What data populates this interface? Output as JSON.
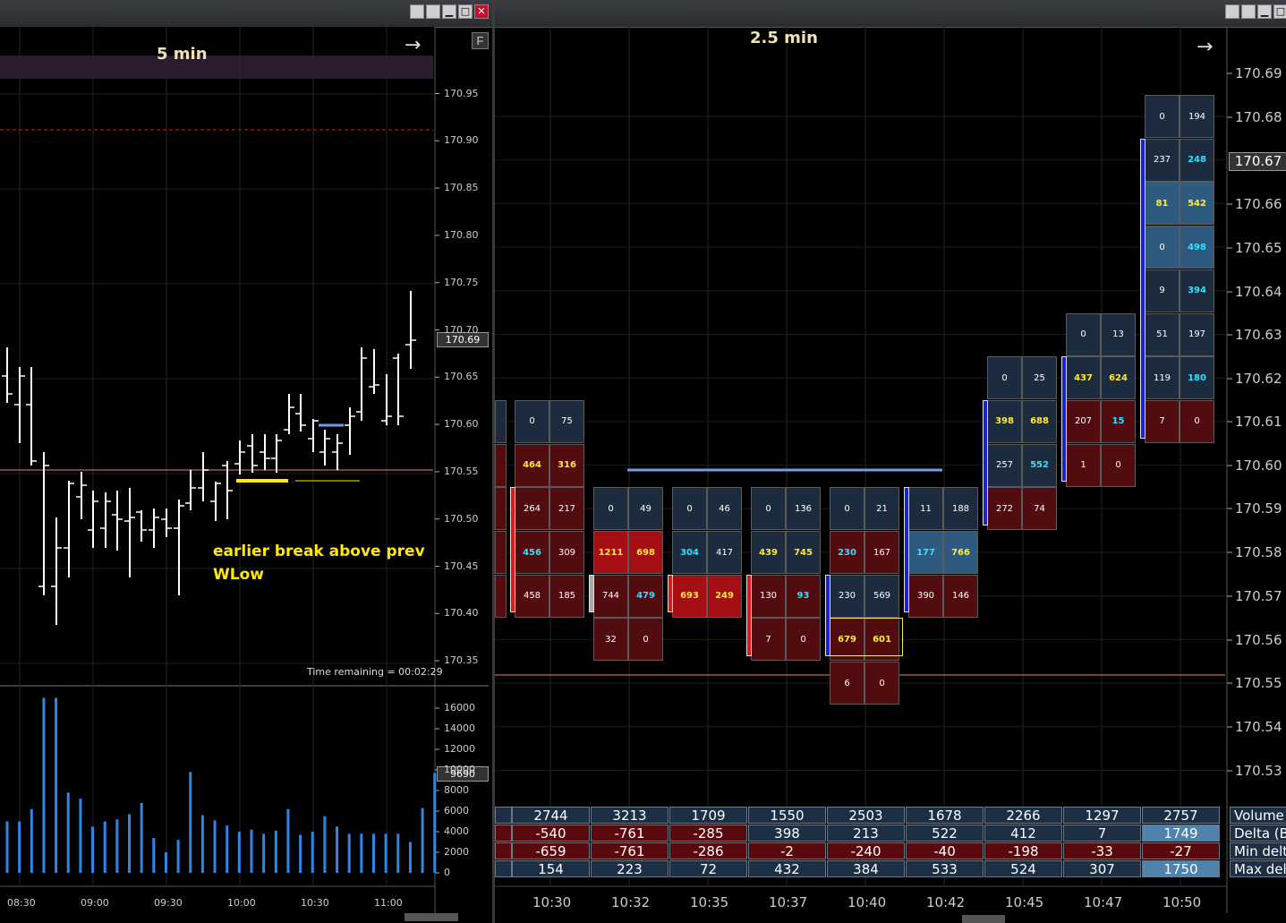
{
  "left_chart": {
    "timeframe_label": "5 min",
    "f_button": "F",
    "price_ticks": [
      "170.95",
      "170.90",
      "170.85",
      "170.80",
      "170.75",
      "170.70",
      "170.65",
      "170.60",
      "170.55",
      "170.50",
      "170.45",
      "170.40",
      "170.35"
    ],
    "last_price_tag": "170.69",
    "annotation_line1": "earlier break above prev",
    "annotation_line2": "WLow",
    "time_remaining": "Time remaining = 00:02:29",
    "volume_ticks": [
      "16000",
      "14000",
      "12000",
      "10000",
      "8000",
      "6000",
      "4000",
      "2000",
      "0"
    ],
    "volume_tag": "9690",
    "time_ticks": [
      "08:30",
      "09:00",
      "09:30",
      "10:00",
      "10:30",
      "11:00"
    ],
    "volume_bars": [
      5000,
      5000,
      6200,
      17000,
      17000,
      7800,
      7200,
      4500,
      5000,
      5200,
      5700,
      6800,
      3400,
      2000,
      3200,
      9800,
      5600,
      5100,
      4600,
      4000,
      4200,
      3800,
      4100,
      6200,
      3700,
      4000,
      5500,
      4500,
      3800,
      3800,
      3800,
      3800,
      3800,
      3000,
      6300,
      9690
    ]
  },
  "right_chart": {
    "timeframe_label": "2.5 min",
    "price_ticks": [
      "170.69",
      "170.68",
      "170.66",
      "170.65",
      "170.64",
      "170.63",
      "170.62",
      "170.61",
      "170.60",
      "170.59",
      "170.58",
      "170.57",
      "170.56",
      "170.55",
      "170.54",
      "170.53"
    ],
    "last_price_tag": "170.67",
    "time_ticks": [
      "10:30",
      "10:32",
      "10:35",
      "10:37",
      "10:40",
      "10:42",
      "10:45",
      "10:47",
      "10:50"
    ],
    "footprint_cells": [
      {
        "col": 0,
        "row": 7,
        "bid": "0",
        "ask": "75",
        "bg": "d",
        "bc": "",
        "ac": ""
      },
      {
        "col": 0,
        "row": 8,
        "bid": "464",
        "ask": "316",
        "bg": "r",
        "bc": "y",
        "ac": "y"
      },
      {
        "col": 0,
        "row": 9,
        "bid": "264",
        "ask": "217",
        "bg": "r",
        "bc": "",
        "ac": ""
      },
      {
        "col": 0,
        "row": 10,
        "bid": "456",
        "ask": "309",
        "bg": "r",
        "bc": "cy",
        "ac": ""
      },
      {
        "col": 0,
        "row": 11,
        "bid": "458",
        "ask": "185",
        "bg": "r",
        "bc": "",
        "ac": ""
      },
      {
        "col": 1,
        "row": 9,
        "bid": "0",
        "ask": "49",
        "bg": "d",
        "bc": "",
        "ac": ""
      },
      {
        "col": 1,
        "row": 10,
        "bid": "1211",
        "ask": "698",
        "bg": "rb",
        "bc": "y",
        "ac": "y"
      },
      {
        "col": 1,
        "row": 11,
        "bid": "744",
        "ask": "479",
        "bg": "r",
        "bc": "",
        "ac": "cy"
      },
      {
        "col": 1,
        "row": 12,
        "bid": "32",
        "ask": "0",
        "bg": "r",
        "bc": "",
        "ac": ""
      },
      {
        "col": 2,
        "row": 9,
        "bid": "0",
        "ask": "46",
        "bg": "d",
        "bc": "",
        "ac": ""
      },
      {
        "col": 2,
        "row": 10,
        "bid": "304",
        "ask": "417",
        "bg": "d",
        "bc": "cy",
        "ac": ""
      },
      {
        "col": 2,
        "row": 11,
        "bid": "693",
        "ask": "249",
        "bg": "rb",
        "bc": "y",
        "ac": "y"
      },
      {
        "col": 3,
        "row": 9,
        "bid": "0",
        "ask": "136",
        "bg": "d",
        "bc": "",
        "ac": ""
      },
      {
        "col": 3,
        "row": 10,
        "bid": "439",
        "ask": "745",
        "bg": "d",
        "bc": "y",
        "ac": "y"
      },
      {
        "col": 3,
        "row": 11,
        "bid": "130",
        "ask": "93",
        "bg": "r",
        "bc": "",
        "ac": "cy"
      },
      {
        "col": 3,
        "row": 12,
        "bid": "7",
        "ask": "0",
        "bg": "r",
        "bc": "",
        "ac": ""
      },
      {
        "col": 4,
        "row": 9,
        "bid": "0",
        "ask": "21",
        "bg": "d",
        "bc": "",
        "ac": ""
      },
      {
        "col": 4,
        "row": 10,
        "bid": "230",
        "ask": "167",
        "bg": "r",
        "bc": "cy",
        "ac": ""
      },
      {
        "col": 4,
        "row": 11,
        "bid": "230",
        "ask": "569",
        "bg": "d",
        "bc": "",
        "ac": ""
      },
      {
        "col": 4,
        "row": 12,
        "bid": "679",
        "ask": "601",
        "bg": "r",
        "bc": "y",
        "ac": "y"
      },
      {
        "col": 4,
        "row": 13,
        "bid": "6",
        "ask": "0",
        "bg": "r",
        "bc": "",
        "ac": ""
      },
      {
        "col": 5,
        "row": 9,
        "bid": "11",
        "ask": "188",
        "bg": "d",
        "bc": "",
        "ac": ""
      },
      {
        "col": 5,
        "row": 10,
        "bid": "177",
        "ask": "766",
        "bg": "b",
        "bc": "cy",
        "ac": "y"
      },
      {
        "col": 5,
        "row": 11,
        "bid": "390",
        "ask": "146",
        "bg": "r",
        "bc": "",
        "ac": ""
      },
      {
        "col": 6,
        "row": 6,
        "bid": "0",
        "ask": "25",
        "bg": "d",
        "bc": "",
        "ac": ""
      },
      {
        "col": 6,
        "row": 7,
        "bid": "398",
        "ask": "688",
        "bg": "d",
        "bc": "y",
        "ac": "y"
      },
      {
        "col": 6,
        "row": 8,
        "bid": "257",
        "ask": "552",
        "bg": "d",
        "bc": "",
        "ac": "cy"
      },
      {
        "col": 6,
        "row": 9,
        "bid": "272",
        "ask": "74",
        "bg": "r",
        "bc": "",
        "ac": ""
      },
      {
        "col": 7,
        "row": 5,
        "bid": "0",
        "ask": "13",
        "bg": "d",
        "bc": "",
        "ac": ""
      },
      {
        "col": 7,
        "row": 6,
        "bid": "437",
        "ask": "624",
        "bg": "d",
        "bc": "y",
        "ac": "y"
      },
      {
        "col": 7,
        "row": 7,
        "bid": "207",
        "ask": "15",
        "bg": "r",
        "bc": "",
        "ac": "cy"
      },
      {
        "col": 7,
        "row": 8,
        "bid": "1",
        "ask": "0",
        "bg": "r",
        "bc": "",
        "ac": ""
      },
      {
        "col": 8,
        "row": 0,
        "bid": "0",
        "ask": "194",
        "bg": "d",
        "bc": "",
        "ac": ""
      },
      {
        "col": 8,
        "row": 1,
        "bid": "237",
        "ask": "248",
        "bg": "d",
        "bc": "",
        "ac": "cy"
      },
      {
        "col": 8,
        "row": 2,
        "bid": "81",
        "ask": "542",
        "bg": "b",
        "bc": "y",
        "ac": "y"
      },
      {
        "col": 8,
        "row": 3,
        "bid": "0",
        "ask": "498",
        "bg": "b",
        "bc": "",
        "ac": "cy"
      },
      {
        "col": 8,
        "row": 4,
        "bid": "9",
        "ask": "394",
        "bg": "d",
        "bc": "",
        "ac": "cy"
      },
      {
        "col": 8,
        "row": 5,
        "bid": "51",
        "ask": "197",
        "bg": "d",
        "bc": "",
        "ac": ""
      },
      {
        "col": 8,
        "row": 6,
        "bid": "119",
        "ask": "180",
        "bg": "d",
        "bc": "",
        "ac": "cy"
      },
      {
        "col": 8,
        "row": 7,
        "bid": "7",
        "ask": "0",
        "bg": "r",
        "bc": "",
        "ac": ""
      }
    ],
    "stats_table": {
      "row_labels": [
        "Volume",
        "Delta (Ba",
        "Min delta",
        "Max delta"
      ],
      "volume": [
        "2744",
        "3213",
        "1709",
        "1550",
        "2503",
        "1678",
        "2266",
        "1297",
        "2757"
      ],
      "delta": [
        "-540",
        "-761",
        "-285",
        "398",
        "213",
        "522",
        "412",
        "7",
        "1749"
      ],
      "min_delta": [
        "-659",
        "-761",
        "-286",
        "-2",
        "-240",
        "-40",
        "-198",
        "-33",
        "-27"
      ],
      "max_delta": [
        "154",
        "223",
        "72",
        "432",
        "384",
        "533",
        "524",
        "307",
        "1750"
      ]
    }
  },
  "colors": {
    "volume_bar": "#2f86e6",
    "support_line": "#c0694a",
    "resistance_dash": "#e01818",
    "highlight_yellow": "#ffea00",
    "level_blue": "#6f9ce6"
  }
}
